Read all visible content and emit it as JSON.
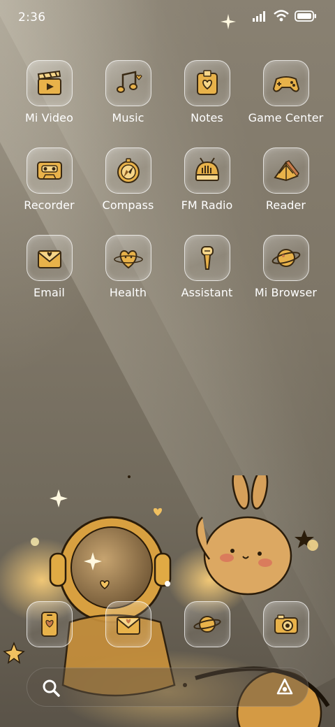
{
  "status_bar": {
    "time": "2:36",
    "icons": [
      "signal-icon",
      "wifi-icon",
      "battery-icon"
    ]
  },
  "apps": [
    {
      "label": "Mi Video",
      "icon": "clapperboard-icon"
    },
    {
      "label": "Music",
      "icon": "music-note-icon"
    },
    {
      "label": "Notes",
      "icon": "notepad-icon"
    },
    {
      "label": "Game Center",
      "icon": "gamepad-icon"
    },
    {
      "label": "Recorder",
      "icon": "cassette-icon"
    },
    {
      "label": "Compass",
      "icon": "compass-icon"
    },
    {
      "label": "FM Radio",
      "icon": "radio-icon"
    },
    {
      "label": "Reader",
      "icon": "book-icon"
    },
    {
      "label": "Email",
      "icon": "envelope-icon"
    },
    {
      "label": "Health",
      "icon": "heart-planet-icon"
    },
    {
      "label": "Assistant",
      "icon": "microphone-icon"
    },
    {
      "label": "Mi Browser",
      "icon": "planet-icon"
    }
  ],
  "dock": [
    {
      "icon": "phone-icon"
    },
    {
      "icon": "message-envelope-icon"
    },
    {
      "icon": "planet-icon"
    },
    {
      "icon": "camera-icon"
    }
  ],
  "search_bar": {
    "left_icon": "search-icon",
    "right_icon": "assistant-a-icon"
  },
  "colors": {
    "accent_gold": "#e8b24a",
    "icon_outline": "#3a2a14",
    "background": "#7e7668"
  }
}
